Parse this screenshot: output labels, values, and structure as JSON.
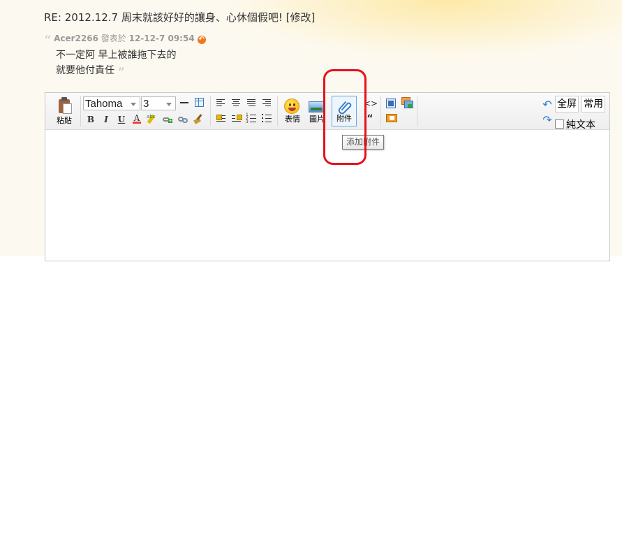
{
  "post": {
    "title": "RE: 2012.12.7 周末就該好好的讓身、心休個假吧!",
    "edit_link": "[修改]"
  },
  "quote": {
    "author": "Acer2266",
    "posted_label": "發表於",
    "time": "12-12-7 09:54",
    "lines": [
      "不一定阿 早上被誰拖下去的",
      "就要他付責任"
    ]
  },
  "toolbar": {
    "paste_label": "粘貼",
    "font_family_value": "Tahoma",
    "font_size_value": "3",
    "bold": "B",
    "italic": "I",
    "underline": "U",
    "font_color": "A",
    "emoticon_label": "表情",
    "image_label": "圖片",
    "attach_label": "附件",
    "fullscreen_label": "全屏",
    "common_label": "常用",
    "plaintext_label": "純文本"
  },
  "tooltip": {
    "text": "添加附件"
  },
  "colors": {
    "highlight": "#e8101a",
    "link_blue": "#2f7fd0",
    "goto_orange": "#ee7a1a"
  }
}
